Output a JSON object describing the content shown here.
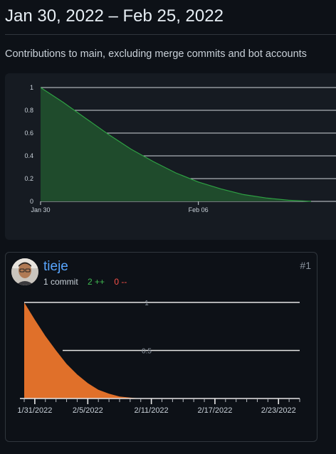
{
  "header": {
    "date_range": "Jan 30, 2022 – Feb 25, 2022",
    "description": "Contributions to main, excluding merge commits and bot accounts"
  },
  "colors": {
    "background": "#0d1117",
    "main_area_fill": "#1f4b2c",
    "main_area_stroke": "#2ea043",
    "user_area_fill": "#e0702a",
    "username_link": "#58a6ff",
    "additions": "#3fb950",
    "deletions": "#f85149"
  },
  "chart_data": [
    {
      "type": "area",
      "x": [
        "Jan 30",
        "Jan 31",
        "Feb 01",
        "Feb 02",
        "Feb 03",
        "Feb 04",
        "Feb 05",
        "Feb 06",
        "Feb 07",
        "Feb 08",
        "Feb 09",
        "Feb 10",
        "Feb 11"
      ],
      "values": [
        1,
        0.87,
        0.73,
        0.59,
        0.46,
        0.35,
        0.25,
        0.17,
        0.11,
        0.06,
        0.03,
        0.01,
        0
      ],
      "xticks": [
        "Jan 30",
        "Feb 06"
      ],
      "yticks": [
        "0",
        "0.2",
        "0.4",
        "0.6",
        "0.8",
        "1"
      ],
      "ylim": [
        0,
        1
      ],
      "grid": true
    },
    {
      "type": "area",
      "x": [
        "1/30/2022",
        "1/31/2022",
        "2/1/2022",
        "2/2/2022",
        "2/3/2022",
        "2/4/2022",
        "2/5/2022",
        "2/6/2022",
        "2/7/2022",
        "2/8/2022",
        "2/9/2022",
        "2/10/2022",
        "2/11/2022"
      ],
      "values": [
        1,
        0.82,
        0.65,
        0.5,
        0.36,
        0.25,
        0.16,
        0.09,
        0.05,
        0.02,
        0.01,
        0,
        0
      ],
      "xticks": [
        "1/31/2022",
        "2/5/2022",
        "2/11/2022",
        "2/17/2022",
        "2/23/2022"
      ],
      "yticks": [
        "1",
        "0.5"
      ],
      "ylim": [
        0,
        1
      ],
      "grid": true
    }
  ],
  "contributor": {
    "username": "tieje",
    "commits": "1 commit",
    "additions": "2 ++",
    "deletions": "0 --",
    "rank": "#1"
  }
}
